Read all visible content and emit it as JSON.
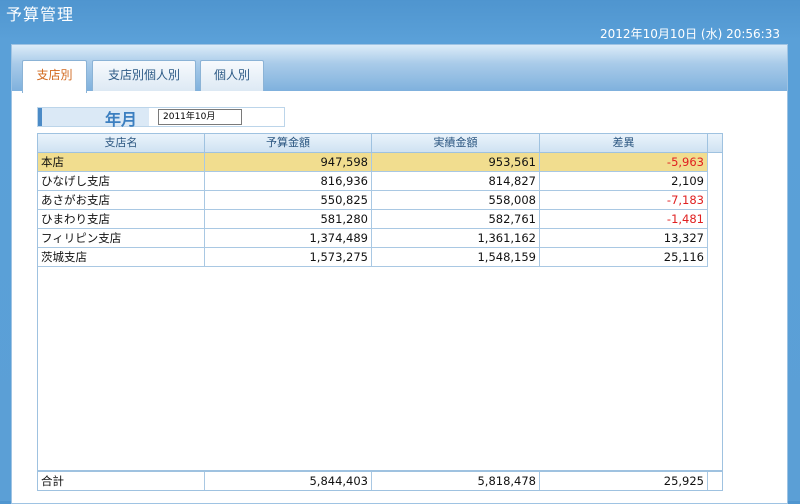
{
  "app": {
    "title": "予算管理",
    "datetime": "2012年10月10日 (水) 20:56:33"
  },
  "tabs": [
    {
      "label": "支店別",
      "active": true
    },
    {
      "label": "支店別個人別",
      "active": false
    },
    {
      "label": "個人別",
      "active": false
    }
  ],
  "filter": {
    "label": "年月",
    "value": "2011年10月"
  },
  "table": {
    "headers": [
      "支店名",
      "予算金額",
      "実績金額",
      "差異"
    ],
    "rows": [
      {
        "name": "本店",
        "budget": "947,598",
        "actual": "953,561",
        "diff": "-5,963",
        "negative": true,
        "selected": true
      },
      {
        "name": "ひなげし支店",
        "budget": "816,936",
        "actual": "814,827",
        "diff": "2,109",
        "negative": false,
        "selected": false
      },
      {
        "name": "あさがお支店",
        "budget": "550,825",
        "actual": "558,008",
        "diff": "-7,183",
        "negative": true,
        "selected": false
      },
      {
        "name": "ひまわり支店",
        "budget": "581,280",
        "actual": "582,761",
        "diff": "-1,481",
        "negative": true,
        "selected": false
      },
      {
        "name": "フィリピン支店",
        "budget": "1,374,489",
        "actual": "1,361,162",
        "diff": "13,327",
        "negative": false,
        "selected": false
      },
      {
        "name": "茨城支店",
        "budget": "1,573,275",
        "actual": "1,548,159",
        "diff": "25,116",
        "negative": false,
        "selected": false
      }
    ],
    "total": {
      "label": "合計",
      "budget": "5,844,403",
      "actual": "5,818,478",
      "diff": "25,925"
    }
  },
  "colors": {
    "negative": "#e02020",
    "selected_row": "#f1dd8f",
    "active_tab_text": "#d2691e"
  }
}
